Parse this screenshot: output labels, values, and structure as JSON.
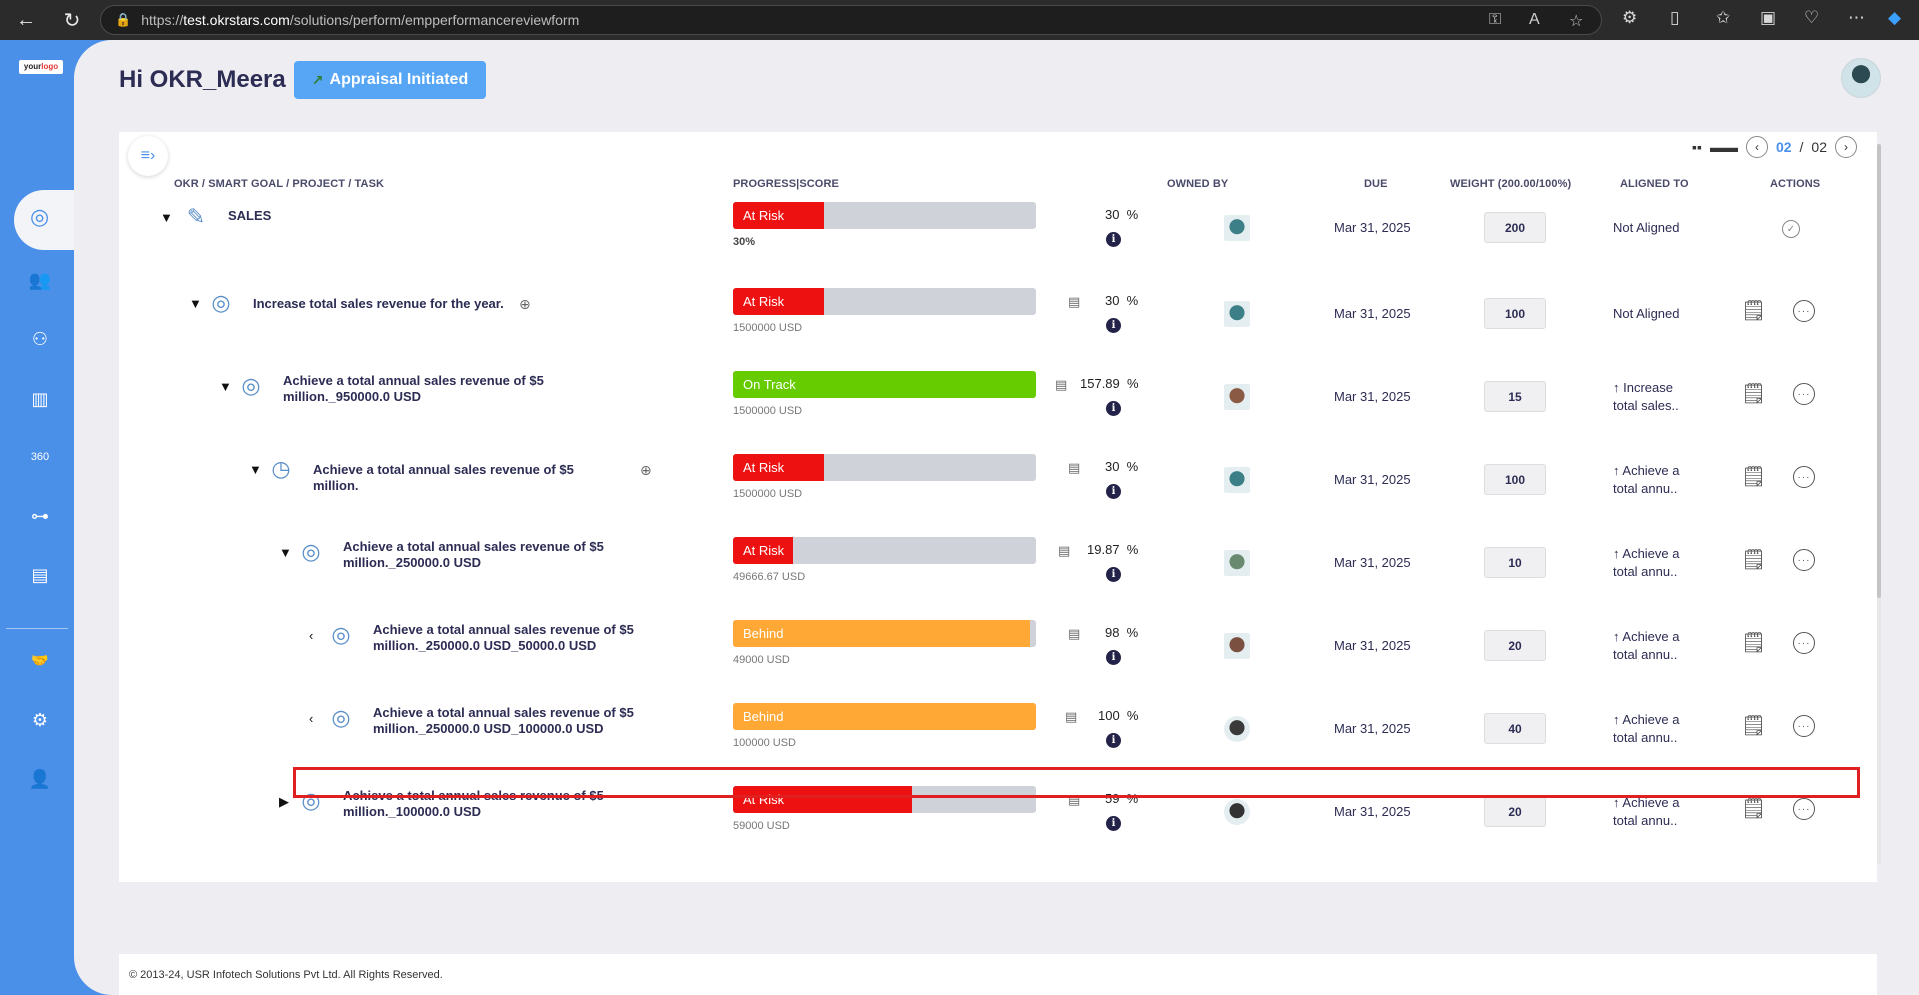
{
  "browser": {
    "url_prefix": "https://",
    "url_domain": "test.okrstars.com",
    "url_path": "/solutions/perform/empperformancereviewform"
  },
  "sidebar": {
    "logo_text_a": "your",
    "logo_text_b": "logo"
  },
  "header": {
    "greeting": "Hi OKR_Meera",
    "appraisal_label": "Appraisal Initiated"
  },
  "pager": {
    "current": "02",
    "sep": "/",
    "total": "02"
  },
  "columns": {
    "okr": "OKR / SMART GOAL / PROJECT / TASK",
    "progress": "PROGRESS|SCORE",
    "owned": "OWNED BY",
    "due": "DUE",
    "weight": "WEIGHT (200.00/100%)",
    "aligned": "ALIGNED TO",
    "actions": "ACTIONS"
  },
  "rows": [
    {
      "title": "SALES",
      "status": "At Risk",
      "progress": 30,
      "color": "#ee1111",
      "sub": "30%",
      "pct": "30  %",
      "due": "Mar 31, 2025",
      "weight": "200",
      "aligned": "Not Aligned"
    },
    {
      "title": "Increase total sales revenue for the year.",
      "status": "At Risk",
      "progress": 30,
      "color": "#ee1111",
      "sub": "1500000 USD",
      "pct": "30  %",
      "due": "Mar 31, 2025",
      "weight": "100",
      "aligned": "Not Aligned"
    },
    {
      "title": "Achieve a total annual sales revenue of $5 million._950000.0 USD",
      "status": "On Track",
      "progress": 100,
      "color": "#66cc00",
      "sub": "1500000 USD",
      "pct": "157.89  %",
      "due": "Mar 31, 2025",
      "weight": "15",
      "aligned": "↑ Increase",
      "aligned2": "total sales.."
    },
    {
      "title": "Achieve a total annual sales revenue of $5 million.",
      "status": "At Risk",
      "progress": 30,
      "color": "#ee1111",
      "sub": "1500000 USD",
      "pct": "30  %",
      "due": "Mar 31, 2025",
      "weight": "100",
      "aligned": "↑ Achieve a",
      "aligned2": "total annu.."
    },
    {
      "title": "Achieve a total annual sales revenue of $5 million._250000.0 USD",
      "status": "At Risk",
      "progress": 19.87,
      "color": "#ee1111",
      "sub": "49666.67 USD",
      "pct": "19.87  %",
      "due": "Mar 31, 2025",
      "weight": "10",
      "aligned": "↑ Achieve a",
      "aligned2": "total annu.."
    },
    {
      "title": "Achieve a total annual sales revenue of $5 million._250000.0 USD_50000.0 USD",
      "status": "Behind",
      "progress": 98,
      "color": "#ffa836",
      "sub": "49000 USD",
      "pct": "98  %",
      "due": "Mar 31, 2025",
      "weight": "20",
      "aligned": "↑ Achieve a",
      "aligned2": "total annu.."
    },
    {
      "title": "Achieve a total annual sales revenue of $5 million._250000.0 USD_100000.0 USD",
      "status": "Behind",
      "progress": 100,
      "color": "#ffa836",
      "sub": "100000 USD",
      "pct": "100  %",
      "due": "Mar 31, 2025",
      "weight": "40",
      "aligned": "↑ Achieve a",
      "aligned2": "total annu.."
    },
    {
      "title": "Achieve a total annual sales revenue of $5 million._100000.0 USD",
      "status": "At Risk",
      "progress": 59,
      "color": "#ee1111",
      "sub": "59000 USD",
      "pct": "59  %",
      "due": "Mar 31, 2025",
      "weight": "20",
      "aligned": "↑ Achieve a",
      "aligned2": "total annu.."
    }
  ],
  "footer": {
    "text": "© 2013-24, USR Infotech Solutions Pvt Ltd. All Rights Reserved."
  }
}
